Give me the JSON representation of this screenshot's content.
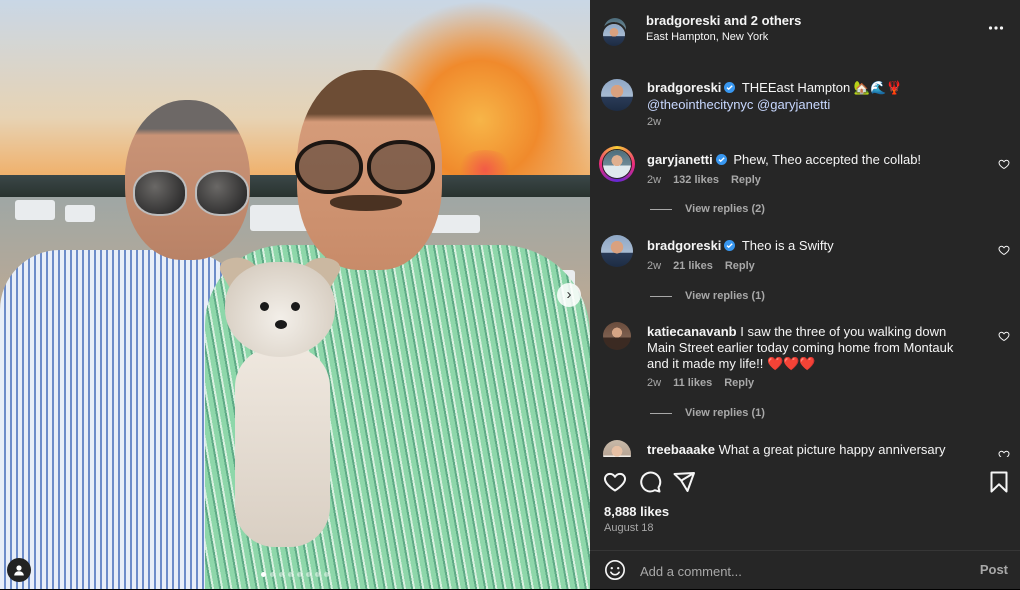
{
  "header": {
    "author": "bradgoreski",
    "collab_suffix": " and 2 others",
    "location": "East Hampton, New York"
  },
  "caption": {
    "username": "bradgoreski",
    "verified": true,
    "text": "THEEast Hampton",
    "emojis": "🏡🌊🦞",
    "mentions": "@theointhecitynyc @garyjanetti",
    "time": "2w"
  },
  "comments": [
    {
      "username": "garyjanetti",
      "verified": true,
      "text": "Phew, Theo accepted the collab!",
      "time": "2w",
      "likes": "132 likes",
      "reply_label": "Reply",
      "view_replies": "View replies (2)"
    },
    {
      "username": "bradgoreski",
      "verified": true,
      "text": "Theo is a Swifty",
      "time": "2w",
      "likes": "21 likes",
      "reply_label": "Reply",
      "view_replies": "View replies (1)"
    },
    {
      "username": "katiecanavanb",
      "verified": false,
      "text": "I saw the three of you walking down Main Street earlier today coming home from Montauk and it made my life!!",
      "emojis": "❤️❤️❤️",
      "time": "2w",
      "likes": "11 likes",
      "reply_label": "Reply",
      "view_replies": "View replies (1)"
    },
    {
      "username": "treebaaake",
      "verified": false,
      "text": "What a great picture happy anniversary"
    }
  ],
  "stats": {
    "likes": "8,888 likes",
    "date": "August 18"
  },
  "comment_box": {
    "placeholder": "Add a comment...",
    "post_label": "Post"
  },
  "carousel": {
    "slide_count": 8,
    "active_index": 0
  },
  "colors": {
    "panel_bg": "#262626",
    "muted_text": "#a8a8a8",
    "verified_blue": "#3897f0",
    "heart_red": "#ff3040"
  }
}
